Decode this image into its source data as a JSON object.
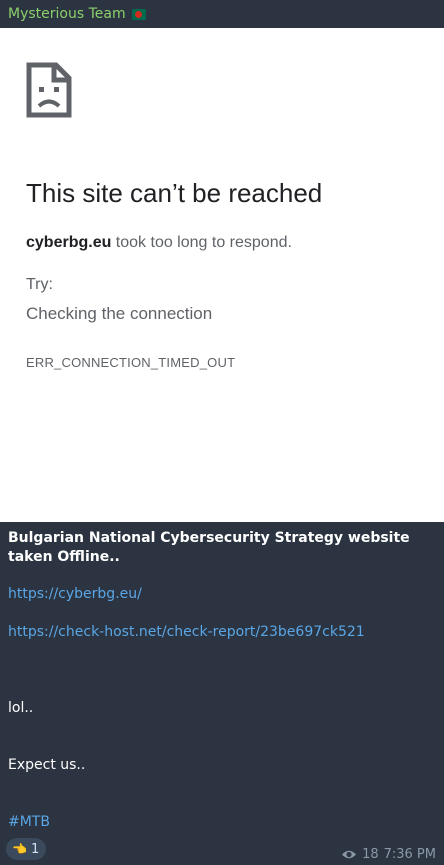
{
  "header": {
    "sender": "Mysterious Team",
    "flag_icon": "bangladesh-flag-icon"
  },
  "screenshot": {
    "title": "This site can’t be reached",
    "domain": "cyberbg.eu",
    "message": " took too long to respond.",
    "try_label": "Try:",
    "suggestion": "Checking the connection",
    "error_code": "ERR_CONNECTION_TIMED_OUT"
  },
  "message": {
    "title": "Bulgarian National Cybersecurity Strategy website taken Offline..",
    "link1": "https://cyberbg.eu/",
    "link2": "https://check-host.net/check-report/23be697ck521",
    "line_lol": "lol..",
    "line_expect": "Expect us..",
    "hashtag": "#MTB"
  },
  "reaction": {
    "emoji": "👈",
    "count": "1"
  },
  "meta": {
    "views": "18",
    "time": "7:36 PM"
  },
  "colors": {
    "sender": "#8bd06b",
    "link": "#5aa6e6",
    "bg": "#2b3440"
  }
}
